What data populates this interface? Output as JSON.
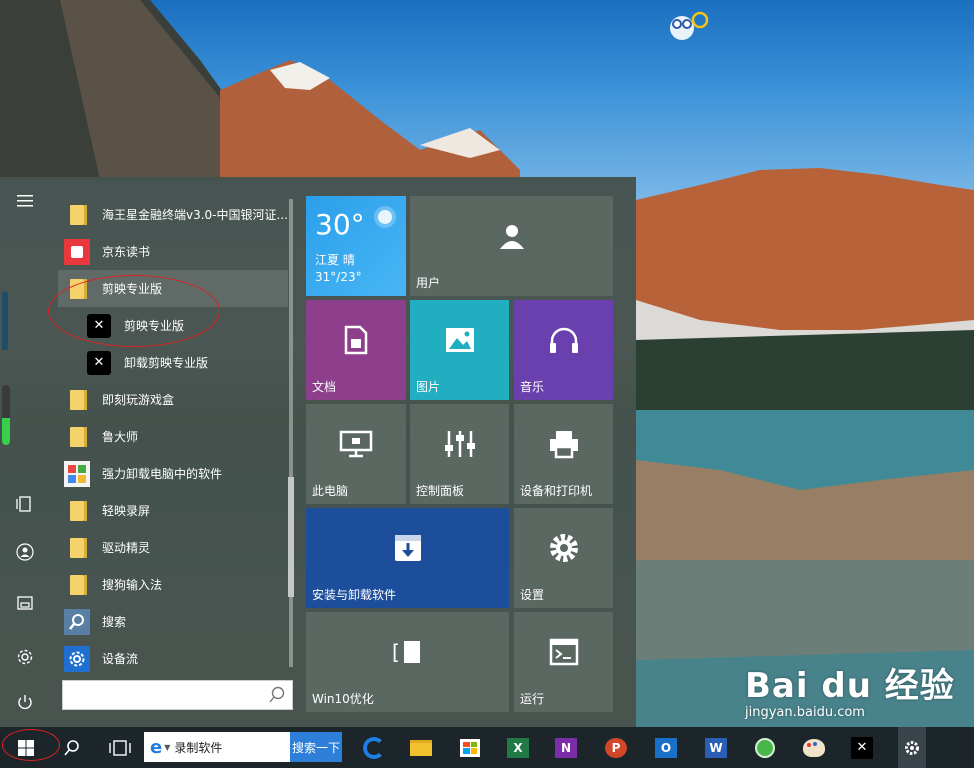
{
  "desktop": {
    "watermark": {
      "brand": "Bai du 经验",
      "url": "jingyan.baidu.com"
    }
  },
  "start_menu": {
    "left_rail": {
      "menu": "hamburger-icon",
      "document": "document-icon",
      "user": "user-icon",
      "pictures": "pictures-icon",
      "settings": "gear-icon",
      "power": "power-icon"
    },
    "app_list": [
      {
        "label": "海王星金融终端v3.0-中国银河证...",
        "icon": "folder"
      },
      {
        "label": "京东读书",
        "icon": "jd-read"
      },
      {
        "label": "剪映专业版",
        "icon": "folder",
        "highlighted": true
      },
      {
        "label": "剪映专业版",
        "icon": "capcut",
        "sub": true
      },
      {
        "label": "卸载剪映专业版",
        "icon": "capcut",
        "sub": true
      },
      {
        "label": "即刻玩游戏盒",
        "icon": "folder"
      },
      {
        "label": "鲁大师",
        "icon": "folder"
      },
      {
        "label": "强力卸载电脑中的软件",
        "icon": "uninstall-tool"
      },
      {
        "label": "轻映录屏",
        "icon": "folder"
      },
      {
        "label": "驱动精灵",
        "icon": "folder"
      },
      {
        "label": "搜狗输入法",
        "icon": "folder"
      },
      {
        "label": "搜索",
        "icon": "search"
      },
      {
        "label": "设备流",
        "icon": "gear-blue"
      }
    ],
    "search": {
      "placeholder": ""
    },
    "tiles": {
      "weather": {
        "temp": "30°",
        "location": "江夏  晴",
        "range": "31°/23°"
      },
      "user": "用户",
      "documents": "文档",
      "pictures": "图片",
      "music": "音乐",
      "this_pc": "此电脑",
      "control_panel": "控制面板",
      "devices_printers": "设备和打印机",
      "install_uninstall": "安装与卸载软件",
      "settings": "设置",
      "win10_optimize": "Win10优化",
      "run": "运行"
    },
    "colors": {
      "documents": "#8e3f8c",
      "pictures": "#20aec0",
      "music": "#6a3fae",
      "install_uninstall": "#1c4e9c",
      "tile_gray": "#5b6862"
    }
  },
  "taskbar": {
    "address_value": "录制软件",
    "search_button": "搜索一下",
    "apps": [
      "edge-icon",
      "file-explorer-icon",
      "store-icon",
      "excel-icon",
      "onenote-icon",
      "powerpoint-icon",
      "outlook-icon",
      "word-icon",
      "network-icon",
      "paint-icon",
      "capcut-icon",
      "settings-icon"
    ]
  }
}
